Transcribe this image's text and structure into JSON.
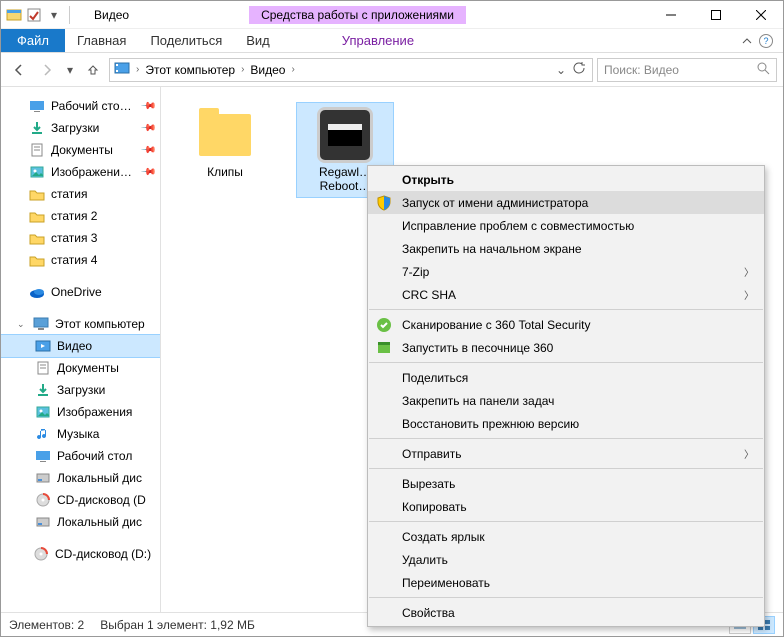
{
  "window": {
    "title": "Видео",
    "contextual_tab_group": "Средства работы с приложениями"
  },
  "ribbon": {
    "file": "Файл",
    "tabs": [
      "Главная",
      "Поделиться",
      "Вид"
    ],
    "contextual_tab": "Управление"
  },
  "breadcrumbs": [
    "Этот компьютер",
    "Видео"
  ],
  "search": {
    "placeholder": "Поиск: Видео"
  },
  "nav": {
    "quick": [
      {
        "label": "Рабочий сто…",
        "icon": "desktop",
        "pinned": true
      },
      {
        "label": "Загрузки",
        "icon": "downloads",
        "pinned": true
      },
      {
        "label": "Документы",
        "icon": "documents",
        "pinned": true
      },
      {
        "label": "Изображени…",
        "icon": "pictures",
        "pinned": true
      },
      {
        "label": "статия",
        "icon": "folder"
      },
      {
        "label": "статия 2",
        "icon": "folder"
      },
      {
        "label": "статия 3",
        "icon": "folder"
      },
      {
        "label": "статия 4",
        "icon": "folder"
      }
    ],
    "onedrive": "OneDrive",
    "thispc_label": "Этот компьютер",
    "thispc": [
      {
        "label": "Видео",
        "icon": "videos",
        "selected": true
      },
      {
        "label": "Документы",
        "icon": "documents"
      },
      {
        "label": "Загрузки",
        "icon": "downloads"
      },
      {
        "label": "Изображения",
        "icon": "pictures"
      },
      {
        "label": "Музыка",
        "icon": "music"
      },
      {
        "label": "Рабочий стол",
        "icon": "desktop"
      },
      {
        "label": "Локальный дис",
        "icon": "disk"
      },
      {
        "label": "CD-дисковод (D",
        "icon": "cd-red"
      },
      {
        "label": "Локальный дис",
        "icon": "disk"
      }
    ],
    "extra_drive": "CD-дисковод (D:)"
  },
  "files": [
    {
      "label": "Клипы",
      "type": "folder"
    },
    {
      "label": "Regawl… Reboot…",
      "type": "app",
      "selected": true
    }
  ],
  "context_menu": [
    {
      "label": "Открыть",
      "bold": true
    },
    {
      "label": "Запуск от имени администратора",
      "icon": "shield",
      "highlighted": true
    },
    {
      "label": "Исправление проблем с совместимостью"
    },
    {
      "label": "Закрепить на начальном экране"
    },
    {
      "label": "7-Zip",
      "submenu": true
    },
    {
      "label": "CRC SHA",
      "submenu": true
    },
    {
      "sep": true
    },
    {
      "label": "Сканирование с 360 Total Security",
      "icon": "sec360"
    },
    {
      "label": "Запустить в песочнице 360",
      "icon": "sec360b"
    },
    {
      "sep": true
    },
    {
      "label": "Поделиться"
    },
    {
      "label": "Закрепить на панели задач"
    },
    {
      "label": "Восстановить прежнюю версию"
    },
    {
      "sep": true
    },
    {
      "label": "Отправить",
      "submenu": true
    },
    {
      "sep": true
    },
    {
      "label": "Вырезать"
    },
    {
      "label": "Копировать"
    },
    {
      "sep": true
    },
    {
      "label": "Создать ярлык"
    },
    {
      "label": "Удалить"
    },
    {
      "label": "Переименовать"
    },
    {
      "sep": true
    },
    {
      "label": "Свойства"
    }
  ],
  "status": {
    "count": "Элементов: 2",
    "selection": "Выбран 1 элемент: 1,92 МБ"
  }
}
